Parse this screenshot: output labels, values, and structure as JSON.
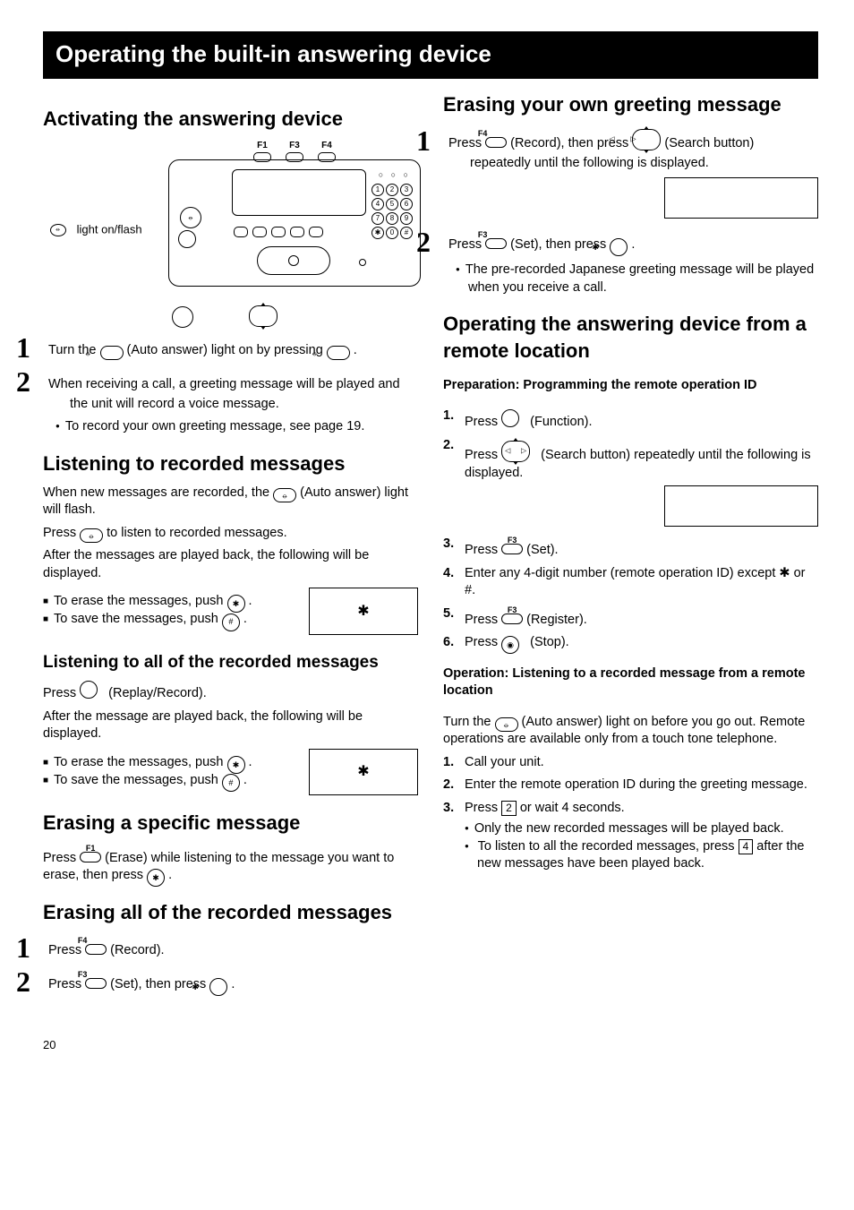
{
  "page_number": "20",
  "titlebar": "Operating the built-in answering device",
  "left": {
    "activating": {
      "heading": "Activating the answering device",
      "diagram": {
        "fkeys": [
          "F1",
          "F3",
          "F4"
        ],
        "light_label": "light on/flash",
        "auto_answer_glyph": "⦵"
      },
      "step1": "Turn the ",
      "step1_iconlabel": "(Auto answer) light on by pressing ",
      "step2": "When receiving a call, a greeting message will be played and the unit will record a voice message.",
      "note1": "To record your own greeting message, see page 19."
    },
    "listening": {
      "heading": "Listening to recorded messages",
      "p1a": "When new messages are recorded, the ",
      "p1b": " (Auto answer) light will flash.",
      "p2a": "Press ",
      "p2b": " to listen to recorded messages.",
      "p3": "After the messages are played back, the following will be displayed.",
      "erase": "To erase the messages, push ",
      "save": "To save the messages, push ",
      "box_glyph": "✱"
    },
    "listen_all": {
      "heading": "Listening to all of the recorded messages",
      "p1a": "Press ",
      "p1b": " (Replay/Record).",
      "p2": "After the message are played back, the following will be displayed.",
      "erase": "To erase the messages, push ",
      "save": "To save the messages, push ",
      "box_glyph": "✱"
    },
    "erase_one": {
      "heading": "Erasing a specific message",
      "p_a": "Press ",
      "p_b": " (Erase) while listening to the message you want to erase, then press ",
      "fkey": "F1"
    },
    "erase_all": {
      "heading": "Erasing all of the recorded messages",
      "step1a": "Press ",
      "step1b": " (Record).",
      "step1_fkey": "F4",
      "step2a": "Press ",
      "step2b": " (Set), then press ",
      "step2_fkey": "F3"
    }
  },
  "right": {
    "erase_greeting": {
      "heading": "Erasing your own greeting message",
      "step1a": "Press ",
      "step1b": " (Record), then press ",
      "step1c": " (Search button) repeatedly until the following is displayed.",
      "step1_fkey": "F4",
      "step2a": "Press ",
      "step2b": " (Set), then press ",
      "step2_fkey": "F3",
      "note": "The pre-recorded Japanese greeting message will be played when you receive a call."
    },
    "remote": {
      "heading": "Operating the answering device from a remote location",
      "prep_heading": "Preparation: Programming the remote operation ID",
      "prep_steps": {
        "s1a": "Press ",
        "s1b": " (Function).",
        "s2a": "Press ",
        "s2b": " (Search button) repeatedly until the following is displayed.",
        "s3a": "Press ",
        "s3b": " (Set).",
        "s3_fkey": "F3",
        "s4": "Enter any 4-digit number (remote operation ID) except ✱ or #.",
        "s5a": "Press ",
        "s5b": " (Register).",
        "s5_fkey": "F3",
        "s6a": "Press ",
        "s6b": " (Stop)."
      },
      "op_heading": "Operation: Listening to a recorded message from a remote location",
      "op_intro_a": "Turn the ",
      "op_intro_b": " (Auto answer) light on before you go out. Remote operations are available only from a touch tone telephone.",
      "op_steps": {
        "s1": "Call your unit.",
        "s2": "Enter the remote operation ID during the greeting message.",
        "s3a": "Press ",
        "s3key": "2",
        "s3b": " or wait 4 seconds.",
        "s3_note1": "Only the new recorded messages will be played back.",
        "s3_note2a": "To listen to all the recorded messages, press ",
        "s3_note2key": "4",
        "s3_note2b": " after the new messages have been played back."
      }
    }
  }
}
